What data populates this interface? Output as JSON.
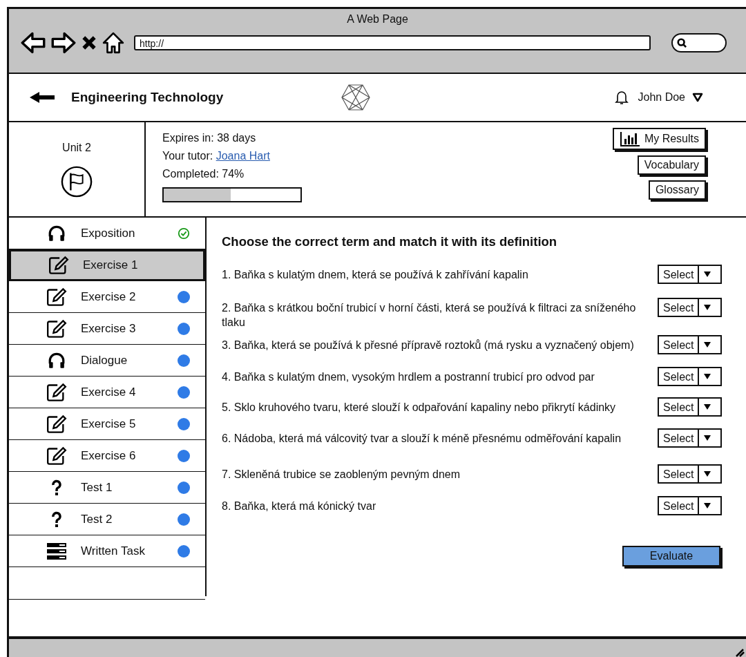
{
  "browser": {
    "title": "A Web Page",
    "url": "http://"
  },
  "header": {
    "title": "Engineering Technology",
    "user": "John Doe"
  },
  "unit": {
    "label": "Unit 2",
    "expires": "Expires in: 38 days",
    "tutor_label": "Your tutor:",
    "tutor": "Joana Hart",
    "completed": "Completed: 74%",
    "level": 0.49
  },
  "actions": [
    {
      "label": "My Results"
    },
    {
      "label": "Vocabulary"
    },
    {
      "label": "Glossary"
    }
  ],
  "nav": [
    {
      "label": "Exposition",
      "kind": "audio",
      "completed": true,
      "selected": false
    },
    {
      "label": "Exercise 1",
      "kind": "edit",
      "completed": false,
      "selected": true
    },
    {
      "label": "Exercise 2",
      "kind": "edit",
      "completed": false,
      "color": "#2f7be6",
      "selected": false
    },
    {
      "label": "Exercise 3",
      "kind": "edit",
      "completed": false,
      "color": "#2f7be6",
      "selected": false
    },
    {
      "label": "Dialogue",
      "kind": "audio",
      "completed": false,
      "color": "#2f7be6",
      "selected": false
    },
    {
      "label": "Exercise 4",
      "kind": "edit",
      "completed": false,
      "color": "#2f7be6",
      "selected": false
    },
    {
      "label": "Exercise 5",
      "kind": "edit",
      "completed": false,
      "color": "#2f7be6",
      "selected": false
    },
    {
      "label": "Exercise 6",
      "kind": "edit",
      "completed": false,
      "color": "#2f7be6",
      "selected": false
    },
    {
      "label": "Test 1",
      "kind": "test",
      "completed": false,
      "color": "#2f7be6",
      "selected": false
    },
    {
      "label": "Test 2",
      "kind": "test",
      "completed": false,
      "color": "#2f7be6",
      "selected": false
    },
    {
      "label": "Written Task",
      "kind": "form",
      "completed": false,
      "color": "#2f7be6",
      "selected": false
    }
  ],
  "exercise": {
    "heading": "Choose the correct term and match it with its definition",
    "questions": [
      {
        "text": "1. Baňka s kulatým dnem, která se používá k zahřívání kapalin",
        "select": "Select"
      },
      {
        "text": "2. Baňka s krátkou boční trubicí v horní části, která se používá k filtraci za sníženého tlaku",
        "select": "Select"
      },
      {
        "text": "3. Baňka, která se používá k přesné přípravě roztoků (má rysku a vyznačený objem)",
        "select": "Select"
      },
      {
        "text": "4. Baňka s kulatým dnem, vysokým hrdlem a postranní trubicí pro odvod par",
        "select": "Select"
      },
      {
        "text": "5. Sklo kruhového tvaru, které slouží k odpařování kapaliny nebo přikrytí kádinky",
        "select": "Select"
      },
      {
        "text": "6. Nádoba, která má válcovitý tvar a slouží k méně přesnému odměřování kapalin",
        "select": "Select"
      },
      {
        "text": "7. Skleněná trubice se zaobleným pevným dnem",
        "select": "Select"
      },
      {
        "text": "8. Baňka, která má kónický tvar",
        "select": "Select"
      }
    ],
    "button": "Evaluate"
  }
}
